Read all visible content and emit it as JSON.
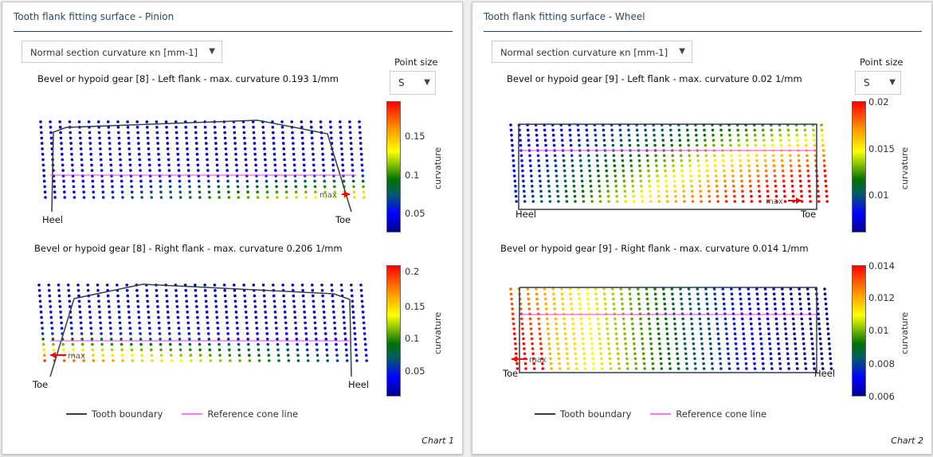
{
  "panels": [
    {
      "title": "Tooth flank fitting surface - Pinion",
      "dropdown": {
        "value": "Normal section curvature κn [mm-1]"
      },
      "point_size": {
        "label": "Point size",
        "value": "S"
      },
      "footer": "Chart 1",
      "legend": [
        {
          "label": "Tooth boundary",
          "color": "#2c3e50"
        },
        {
          "label": "Reference cone line",
          "color": "#ff66ff"
        }
      ]
    },
    {
      "title": "Tooth flank fitting surface - Wheel",
      "dropdown": {
        "value": "Normal section curvature κn [mm-1]"
      },
      "point_size": {
        "label": "Point size",
        "value": "S"
      },
      "footer": "Chart 2",
      "legend": [
        {
          "label": "Tooth boundary",
          "color": "#2c3e50"
        },
        {
          "label": "Reference cone line",
          "color": "#ff66ff"
        }
      ]
    }
  ],
  "chart_data": [
    {
      "type": "scatter",
      "title": "Bevel or hypoid gear [8] - Left flank - max. curvature 0.193 1/mm",
      "left_label": "Heel",
      "right_label": "Toe",
      "max_label": "max",
      "colorbar": {
        "label": "curvature",
        "range": [
          0.02,
          0.193
        ],
        "ticks": [
          "0.15",
          "0.1",
          "0.05"
        ]
      },
      "max_side": "right",
      "gradient": "bottom-right"
    },
    {
      "type": "scatter",
      "title": "Bevel or hypoid gear [8] - Right flank - max. curvature 0.206 1/mm",
      "left_label": "Toe",
      "right_label": "Heel",
      "max_label": "max",
      "colorbar": {
        "label": "curvature",
        "range": [
          0.01,
          0.206
        ],
        "ticks": [
          "0.2",
          "0.15",
          "0.1",
          "0.05"
        ]
      },
      "max_side": "left",
      "gradient": "bottom-left"
    },
    {
      "type": "scatter",
      "title": "Bevel or hypoid gear [9] - Left flank - max. curvature 0.02 1/mm",
      "left_label": "Heel",
      "right_label": "Toe",
      "max_label": "max",
      "colorbar": {
        "label": "curvature",
        "range": [
          0.006,
          0.02
        ],
        "ticks": [
          "0.02",
          "0.015",
          "0.01"
        ]
      },
      "max_side": "right",
      "gradient": "bottom-right"
    },
    {
      "type": "scatter",
      "title": "Bevel or hypoid gear [9] - Right flank - max. curvature 0.014 1/mm",
      "left_label": "Toe",
      "right_label": "Heel",
      "max_label": "max",
      "colorbar": {
        "label": "curvature",
        "range": [
          0.006,
          0.014
        ],
        "ticks": [
          "0.014",
          "0.012",
          "0.01",
          "0.008",
          "0.006"
        ]
      },
      "max_side": "left",
      "gradient": "left"
    }
  ]
}
